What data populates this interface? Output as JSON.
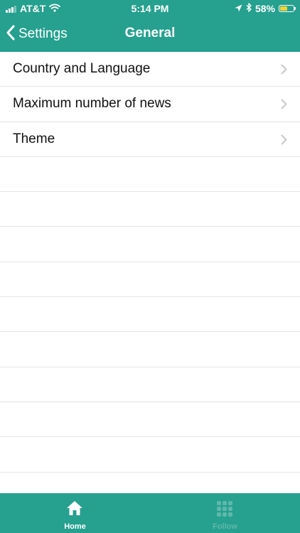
{
  "status_bar": {
    "carrier": "AT&T",
    "time": "5:14 PM",
    "battery_percent": "58%",
    "battery_level": 0.58,
    "icons": [
      "signal-icon",
      "wifi-icon",
      "location-icon",
      "bluetooth-icon",
      "battery-icon"
    ]
  },
  "nav": {
    "back_label": "Settings",
    "title": "General"
  },
  "settings_items": [
    {
      "label": "Country and Language"
    },
    {
      "label": "Maximum number of news"
    },
    {
      "label": "Theme"
    }
  ],
  "tab_bar": {
    "tabs": [
      {
        "label": "Home",
        "icon": "home-icon",
        "active": true
      },
      {
        "label": "Follow",
        "icon": "grid-icon",
        "active": false
      }
    ]
  },
  "colors": {
    "brand": "#26a08f",
    "battery": "#f3d235",
    "inactive_tab": "#5fb8ab",
    "divider": "#e4e4e4",
    "chevron": "#c7c7cc"
  }
}
